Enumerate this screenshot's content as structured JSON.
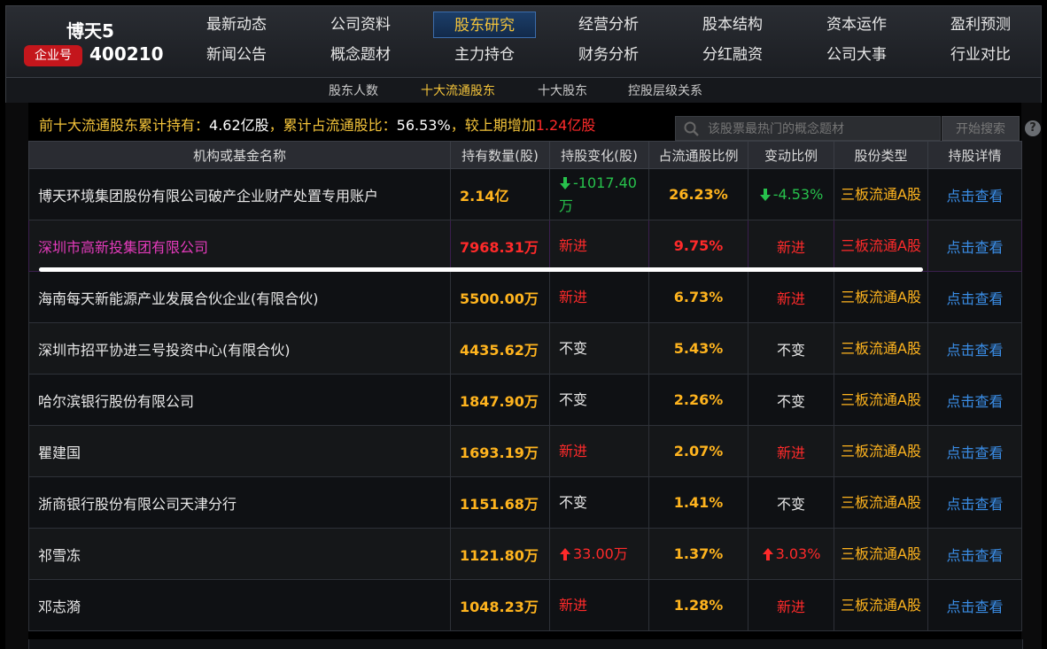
{
  "header": {
    "stock_name": "博天5",
    "badge": "企业号",
    "stock_code": "400210"
  },
  "nav": {
    "row1": [
      "最新动态",
      "公司资料",
      "股东研究",
      "经营分析",
      "股本结构",
      "资本运作",
      "盈利预测"
    ],
    "row2": [
      "新闻公告",
      "概念题材",
      "主力持仓",
      "财务分析",
      "分红融资",
      "公司大事",
      "行业对比"
    ],
    "active": "股东研究"
  },
  "subnav": {
    "items": [
      "股东人数",
      "十大流通股东",
      "十大股东",
      "控股层级关系"
    ],
    "active": "十大流通股东"
  },
  "summary": {
    "label1": "前十大流通股东累计持有：",
    "value1": "4.62亿股",
    "label2": "，累计占流通股比：",
    "value2": "56.53%",
    "label3": "，较上期增加",
    "value3": "1.24亿股"
  },
  "search": {
    "placeholder": "该股票最热门的概念题材",
    "button": "开始搜索"
  },
  "table": {
    "headers": [
      "机构或基金名称",
      "持有数量(股)",
      "持股变化(股)",
      "占流通股比例",
      "变动比例",
      "股份类型",
      "持股详情"
    ],
    "rows": [
      {
        "name": "博天环境集团股份有限公司破产企业财产处置专用账户",
        "qty": "2.14亿",
        "change": "-1017.40万",
        "change_dir": "down",
        "ratio": "26.23%",
        "chg_ratio": "-4.53%",
        "chg_dir": "down",
        "type": "三板流通A股",
        "detail": "点击查看"
      },
      {
        "name": "深圳市高新投集团有限公司",
        "qty": "7968.31万",
        "change": "新进",
        "change_dir": "new",
        "ratio": "9.75%",
        "chg_ratio": "新进",
        "chg_dir": "new",
        "type": "三板流通A股",
        "detail": "点击查看"
      },
      {
        "name": "海南每天新能源产业发展合伙企业(有限合伙)",
        "qty": "5500.00万",
        "change": "新进",
        "change_dir": "new",
        "ratio": "6.73%",
        "chg_ratio": "新进",
        "chg_dir": "new",
        "type": "三板流通A股",
        "detail": "点击查看"
      },
      {
        "name": "深圳市招平协进三号投资中心(有限合伙)",
        "qty": "4435.62万",
        "change": "不变",
        "change_dir": "same",
        "ratio": "5.43%",
        "chg_ratio": "不变",
        "chg_dir": "same",
        "type": "三板流通A股",
        "detail": "点击查看"
      },
      {
        "name": "哈尔滨银行股份有限公司",
        "qty": "1847.90万",
        "change": "不变",
        "change_dir": "same",
        "ratio": "2.26%",
        "chg_ratio": "不变",
        "chg_dir": "same",
        "type": "三板流通A股",
        "detail": "点击查看"
      },
      {
        "name": "瞿建国",
        "qty": "1693.19万",
        "change": "新进",
        "change_dir": "new",
        "ratio": "2.07%",
        "chg_ratio": "新进",
        "chg_dir": "new",
        "type": "三板流通A股",
        "detail": "点击查看"
      },
      {
        "name": "浙商银行股份有限公司天津分行",
        "qty": "1151.68万",
        "change": "不变",
        "change_dir": "same",
        "ratio": "1.41%",
        "chg_ratio": "不变",
        "chg_dir": "same",
        "type": "三板流通A股",
        "detail": "点击查看"
      },
      {
        "name": "祁雪冻",
        "qty": "1121.80万",
        "change": "33.00万",
        "change_dir": "up",
        "ratio": "1.37%",
        "chg_ratio": "3.03%",
        "chg_dir": "up",
        "type": "三板流通A股",
        "detail": "点击查看"
      },
      {
        "name": "邓志漪",
        "qty": "1048.23万",
        "change": "新进",
        "change_dir": "new",
        "ratio": "1.28%",
        "chg_ratio": "新进",
        "chg_dir": "new",
        "type": "三板流通A股",
        "detail": "点击查看"
      }
    ]
  },
  "colors": {
    "accent": "#f3c33a",
    "up": "#ff2a2a",
    "down": "#27c24c",
    "link": "#3a8de6"
  }
}
